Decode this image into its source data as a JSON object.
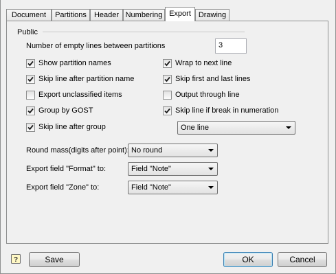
{
  "tabs": [
    "Document",
    "Partitions",
    "Header",
    "Numbering",
    "Export",
    "Drawing"
  ],
  "active_tab": "Export",
  "group": {
    "label": "Public"
  },
  "empty_lines": {
    "label": "Number of empty lines between partitions",
    "value": "3"
  },
  "checkboxes": {
    "show_partition_names": {
      "label": "Show partition names",
      "checked": true
    },
    "skip_line_after_partition_name": {
      "label": "Skip line after partition name",
      "checked": true
    },
    "export_unclassified_items": {
      "label": "Export unclassified items",
      "checked": false
    },
    "group_by_gost": {
      "label": "Group by GOST",
      "checked": true
    },
    "skip_line_after_group": {
      "label": "Skip line after group",
      "checked": true
    },
    "wrap_to_next_line": {
      "label": "Wrap to next line",
      "checked": true
    },
    "skip_first_and_last_lines": {
      "label": "Skip first and last lines",
      "checked": true
    },
    "output_through_line": {
      "label": "Output through line",
      "checked": false
    },
    "skip_line_if_break": {
      "label": "Skip line if break in numeration",
      "checked": true
    }
  },
  "line_select": {
    "value": "One line"
  },
  "round_mass": {
    "label": "Round mass(digits after point):",
    "value": "No round"
  },
  "export_format": {
    "label": "Export field  \"Format\" to:",
    "value": "Field \"Note\""
  },
  "export_zone": {
    "label": "Export field  \"Zone\" to:",
    "value": "Field \"Note\""
  },
  "buttons": {
    "save": "Save",
    "ok": "OK",
    "cancel": "Cancel"
  },
  "colors": {
    "check": "#1a1a1a",
    "border": "#8e8f8f",
    "default_button_border": "#3c7fb1"
  }
}
